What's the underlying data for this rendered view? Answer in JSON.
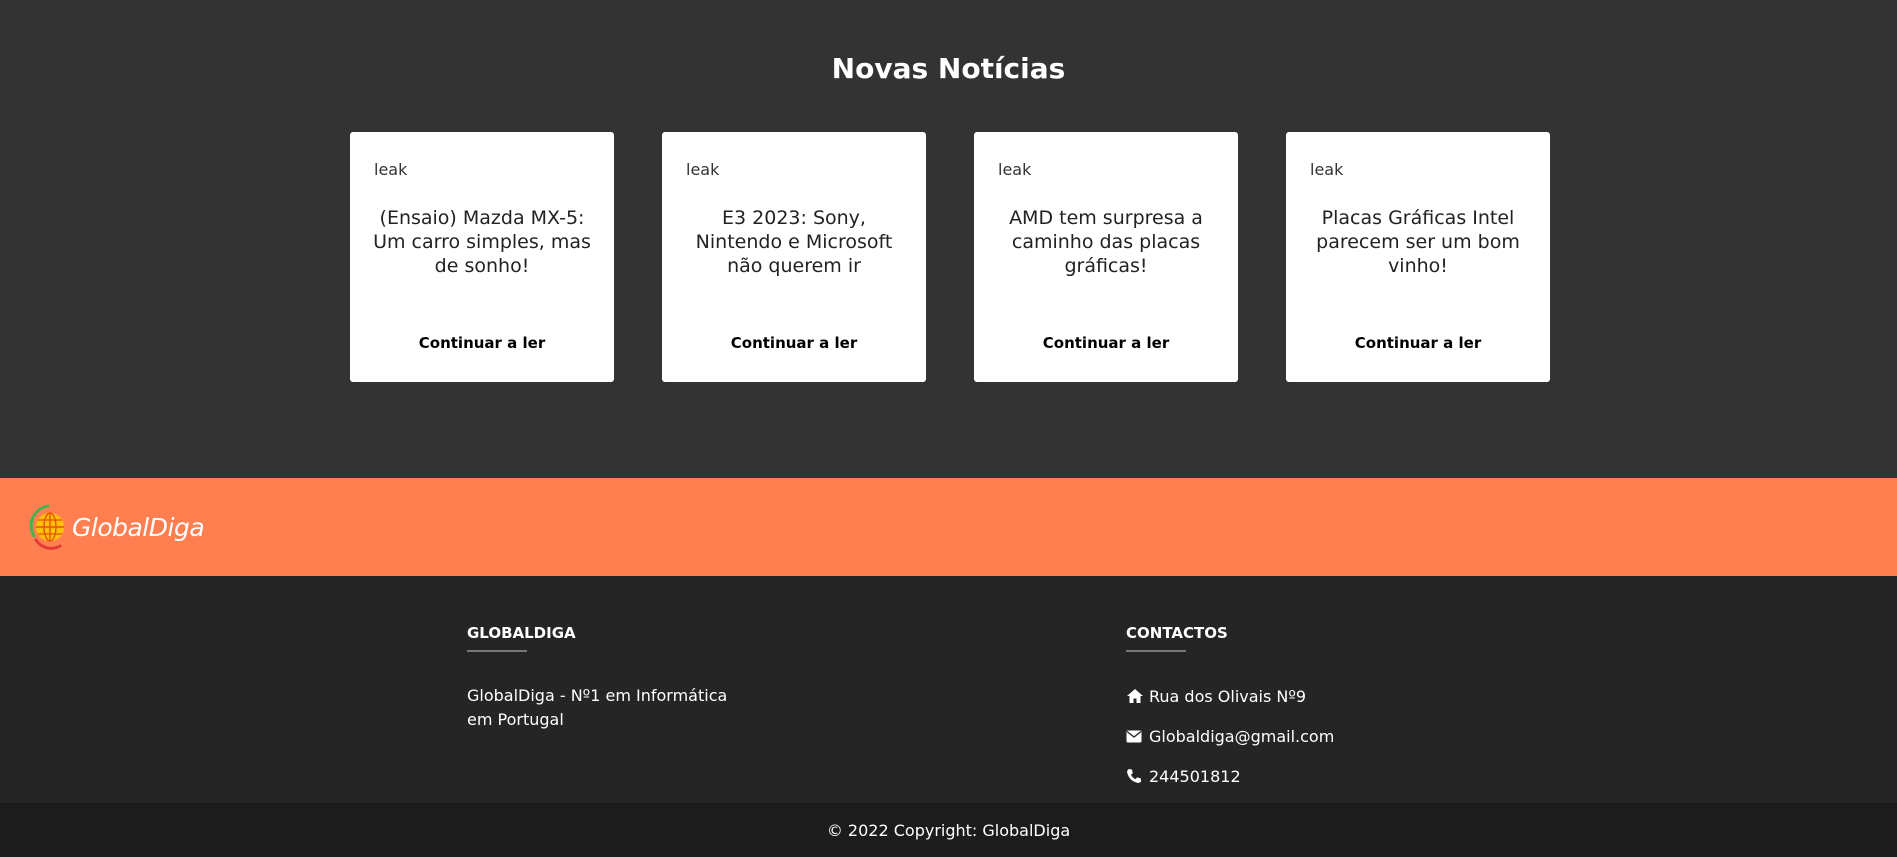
{
  "news": {
    "title": "Novas Notícias",
    "cards": [
      {
        "tag": "leak",
        "title": "(Ensaio) Mazda MX-5: Um carro simples, mas de sonho!",
        "link": "Continuar a ler"
      },
      {
        "tag": "leak",
        "title": "E3 2023: Sony, Nintendo e Microsoft não querem ir",
        "link": "Continuar a ler"
      },
      {
        "tag": "leak",
        "title": "AMD tem surpresa a caminho das placas gráficas!",
        "link": "Continuar a ler"
      },
      {
        "tag": "leak",
        "title": "Placas Gráficas Intel parecem ser um bom vinho!",
        "link": "Continuar a ler"
      }
    ]
  },
  "brand": {
    "logo_text": "GlobalDiga",
    "logo_icon": "globe-icon",
    "bar_color": "#ff7f50"
  },
  "footer": {
    "about": {
      "heading": "GlobalDiga",
      "text": "GlobalDiga - Nº1 em Informática em Portugal"
    },
    "contacts": {
      "heading": "Contactos",
      "items": [
        {
          "icon": "home-icon",
          "text": "Rua dos Olivais Nº9"
        },
        {
          "icon": "envelope-icon",
          "text": "Globaldiga@gmail.com"
        },
        {
          "icon": "phone-icon",
          "text": "244501812"
        }
      ]
    }
  },
  "copyright": "© 2022 Copyright: GlobalDiga"
}
